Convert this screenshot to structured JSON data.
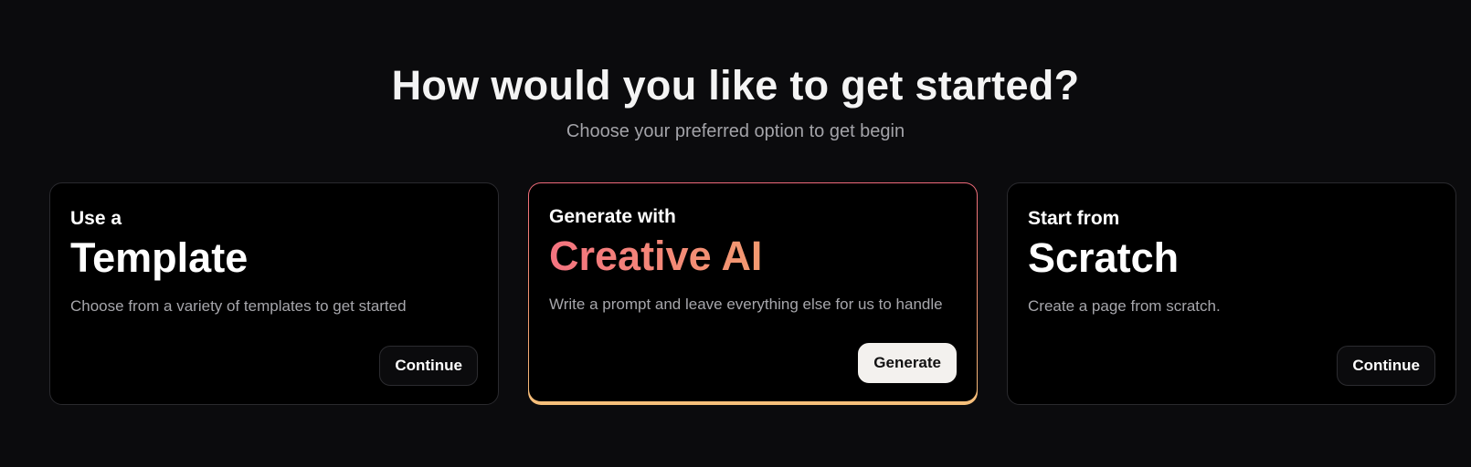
{
  "header": {
    "title": "How would you like to get started?",
    "subtitle": "Choose your preferred option to get begin"
  },
  "options": [
    {
      "kicker": "Use a",
      "title": "Template",
      "description": "Choose from a variety of templates to get started",
      "button_label": "Continue"
    },
    {
      "kicker": "Generate with",
      "title": "Creative AI",
      "description": "Write a prompt and leave everything else for us to handle",
      "button_label": "Generate"
    },
    {
      "kicker": "Start from",
      "title": "Scratch",
      "description": "Create a page from scratch.",
      "button_label": "Continue"
    }
  ],
  "colors": {
    "background": "#0b0b0d",
    "card_background": "#000000",
    "accent_gradient_start": "#f47380",
    "accent_gradient_end": "#f6c07a",
    "primary_button": "#f3f1ee"
  }
}
